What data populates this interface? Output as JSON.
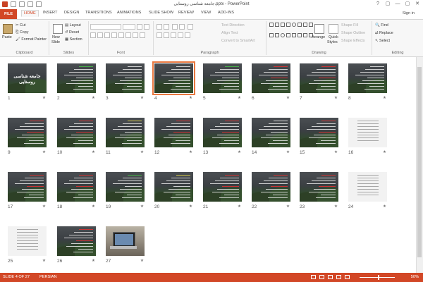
{
  "window": {
    "title": "جامعه شناسی روستایی.pptx - PowerPoint",
    "controls": [
      "?",
      "▢",
      "—",
      "▢",
      "✕"
    ]
  },
  "tabs": {
    "file": "FILE",
    "items": [
      "HOME",
      "INSERT",
      "DESIGN",
      "TRANSITIONS",
      "ANIMATIONS",
      "SLIDE SHOW",
      "REVIEW",
      "VIEW",
      "ADD-INS"
    ],
    "active": "HOME",
    "signin": "Sign in"
  },
  "ribbon": {
    "clipboard": {
      "label": "Clipboard",
      "paste": "Paste",
      "cut": "Cut",
      "copy": "Copy",
      "format_painter": "Format Painter"
    },
    "slides": {
      "label": "Slides",
      "new_slide": "New",
      "new_slide2": "Slide",
      "layout": "Layout",
      "reset": "Reset",
      "section": "Section"
    },
    "font": {
      "label": "Font"
    },
    "paragraph": {
      "label": "Paragraph",
      "text_direction": "Text Direction",
      "align_text": "Align Text",
      "smartart": "Convert to SmartArt"
    },
    "drawing": {
      "label": "Drawing",
      "arrange": "Arrange",
      "quick_styles": "Quick",
      "quick_styles2": "Styles",
      "shape_fill": "Shape Fill",
      "shape_outline": "Shape Outline",
      "shape_effects": "Shape Effects"
    },
    "editing": {
      "label": "Editing",
      "find": "Find",
      "replace": "Replace",
      "select": "Select"
    }
  },
  "slides": [
    {
      "n": "1",
      "kind": "title",
      "title": "جامعه شناسی روستایی"
    },
    {
      "n": "2",
      "kind": "text",
      "accent": "g"
    },
    {
      "n": "3",
      "kind": "text",
      "accent": ""
    },
    {
      "n": "4",
      "kind": "text",
      "accent": "",
      "selected": true
    },
    {
      "n": "5",
      "kind": "text",
      "accent": "g"
    },
    {
      "n": "6",
      "kind": "text",
      "accent": "r"
    },
    {
      "n": "7",
      "kind": "text",
      "accent": "r"
    },
    {
      "n": "8",
      "kind": "text",
      "accent": ""
    },
    {
      "n": "9",
      "kind": "text",
      "accent": "r"
    },
    {
      "n": "10",
      "kind": "text",
      "accent": "r"
    },
    {
      "n": "11",
      "kind": "text",
      "accent": "y"
    },
    {
      "n": "12",
      "kind": "text",
      "accent": "r"
    },
    {
      "n": "13",
      "kind": "text",
      "accent": "r"
    },
    {
      "n": "14",
      "kind": "text",
      "accent": ""
    },
    {
      "n": "15",
      "kind": "text",
      "accent": "r"
    },
    {
      "n": "16",
      "kind": "doc",
      "accent": ""
    },
    {
      "n": "17",
      "kind": "text",
      "accent": "r"
    },
    {
      "n": "18",
      "kind": "text",
      "accent": "r"
    },
    {
      "n": "19",
      "kind": "text",
      "accent": "g"
    },
    {
      "n": "20",
      "kind": "text",
      "accent": "y"
    },
    {
      "n": "21",
      "kind": "text",
      "accent": "r"
    },
    {
      "n": "22",
      "kind": "text",
      "accent": "r"
    },
    {
      "n": "23",
      "kind": "text",
      "accent": "r"
    },
    {
      "n": "24",
      "kind": "doc",
      "accent": ""
    },
    {
      "n": "25",
      "kind": "doc",
      "accent": ""
    },
    {
      "n": "26",
      "kind": "text",
      "accent": "r"
    },
    {
      "n": "27",
      "kind": "photo",
      "accent": ""
    }
  ],
  "status": {
    "slide_info": "SLIDE 4 OF 27",
    "language": "PERSIAN",
    "zoom": "50%"
  },
  "colors": {
    "accent": "#d24726",
    "selection": "#e8773f"
  }
}
